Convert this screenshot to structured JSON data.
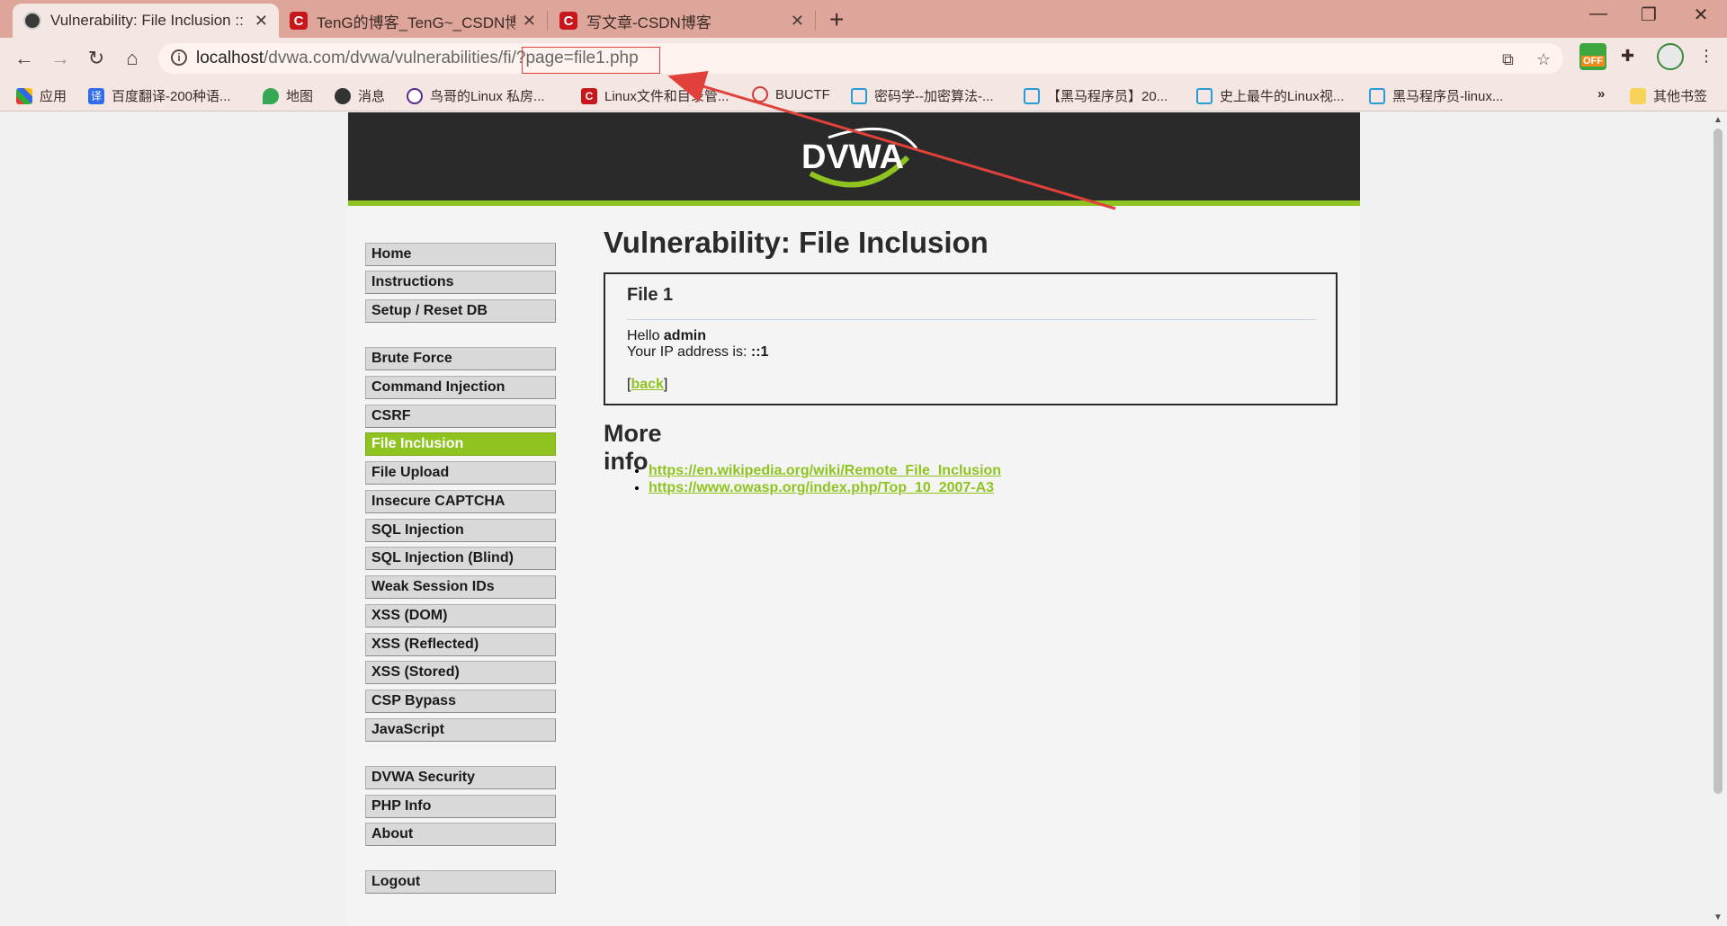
{
  "browser": {
    "tabs": [
      {
        "title": "Vulnerability: File Inclusion :: D",
        "favicon": "dvwa-icon",
        "active": true
      },
      {
        "title": "TenG的博客_TenG~_CSDN博客",
        "favicon": "csdn-icon",
        "active": false
      },
      {
        "title": "写文章-CSDN博客",
        "favicon": "csdn-icon",
        "active": false
      }
    ],
    "url_host": "localhost",
    "url_path": "/dvwa.com/dvwa/vulnerabilities/fi/",
    "url_query": "?page=file1.php",
    "bookmarks": [
      {
        "label": "应用",
        "icon": "apps-grid-icon"
      },
      {
        "label": "百度翻译-200种语...",
        "icon": "translate-icon",
        "glyph": "译"
      },
      {
        "label": "地图",
        "icon": "map-pin-icon"
      },
      {
        "label": "消息",
        "icon": "globe-icon"
      },
      {
        "label": "鸟哥的Linux 私房...",
        "icon": "linux-icon"
      },
      {
        "label": "Linux文件和目录管...",
        "icon": "csdn-icon",
        "glyph": "C"
      },
      {
        "label": "BUUCTF",
        "icon": "buuctf-icon"
      },
      {
        "label": "密码学--加密算法-...",
        "icon": "bilibili-icon"
      },
      {
        "label": "【黑马程序员】20...",
        "icon": "bilibili-icon"
      },
      {
        "label": "史上最牛的Linux视...",
        "icon": "bilibili-icon"
      },
      {
        "label": "黑马程序员-linux...",
        "icon": "bilibili-icon"
      }
    ],
    "other_bookmarks": "其他书签",
    "more_bookmarks": "»",
    "extension_badge": "OFF"
  },
  "site": {
    "logo_text": "DVWA",
    "menu": {
      "group1": [
        "Home",
        "Instructions",
        "Setup / Reset DB"
      ],
      "group2": [
        "Brute Force",
        "Command Injection",
        "CSRF",
        "File Inclusion",
        "File Upload",
        "Insecure CAPTCHA",
        "SQL Injection",
        "SQL Injection (Blind)",
        "Weak Session IDs",
        "XSS (DOM)",
        "XSS (Reflected)",
        "XSS (Stored)",
        "CSP Bypass",
        "JavaScript"
      ],
      "group3": [
        "DVWA Security",
        "PHP Info",
        "About"
      ],
      "group4": [
        "Logout"
      ],
      "selected": "File Inclusion"
    },
    "page_title": "Vulnerability: File Inclusion",
    "box": {
      "heading": "File 1",
      "hello_prefix": "Hello ",
      "user": "admin",
      "ip_prefix": "Your IP address is: ",
      "ip": "::1",
      "back_open": "[",
      "back_label": "back",
      "back_close": "]"
    },
    "more_info_title": "More info",
    "links": [
      "https://en.wikipedia.org/wiki/Remote_File_Inclusion",
      "https://www.owasp.org/index.php/Top_10_2007-A3"
    ]
  },
  "colors": {
    "accent": "#8fc31f",
    "header": "#2a2a2a",
    "annotation": "#e0413a",
    "chrome": "#dea69b"
  }
}
